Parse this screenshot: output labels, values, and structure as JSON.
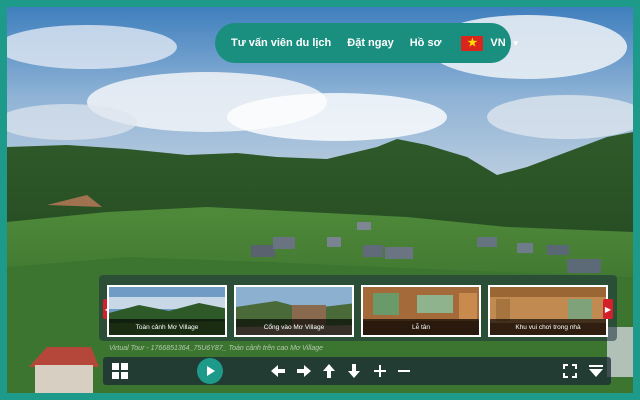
{
  "nav": {
    "items": [
      "Tư vấn viên du lịch",
      "Đặt ngay",
      "Hồ sơ"
    ],
    "language": "VN"
  },
  "thumbnails": [
    {
      "caption": "Toàn cảnh Mơ Village"
    },
    {
      "caption": "Cổng vào Mơ Village"
    },
    {
      "caption": "Lễ tân"
    },
    {
      "caption": "Khu vui chơi trong nhà"
    }
  ],
  "tour_info": "Virtual Tour - 1766851364_75U6Y87_ Toàn cảnh trên cao Mơ Village",
  "controls": {
    "icons": [
      "grid-icon",
      "play-icon",
      "arrow-left-icon",
      "arrow-right-icon",
      "arrow-up-icon",
      "arrow-down-icon",
      "zoom-in-icon",
      "zoom-out-icon",
      "fullscreen-icon",
      "hide-controls-icon"
    ]
  },
  "colors": {
    "accent": "#1d9a8a",
    "nav_arrow": "#d3202a",
    "flag_red": "#da251d",
    "flag_star": "#ffde00"
  }
}
